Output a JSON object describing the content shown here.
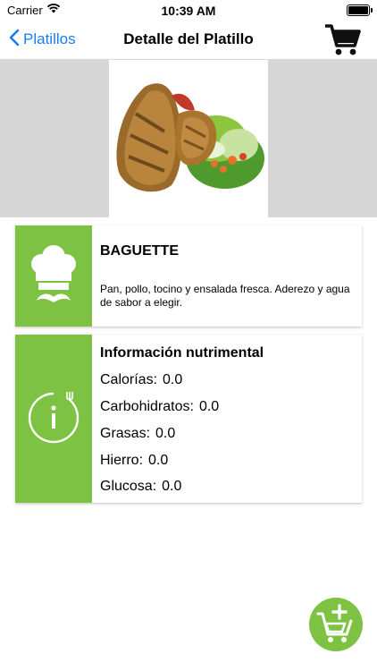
{
  "status_bar": {
    "carrier": "Carrier",
    "time": "10:39 AM"
  },
  "nav": {
    "back_label": "Platillos",
    "title": "Detalle del Platillo"
  },
  "dish": {
    "name": "BAGUETTE",
    "description": "Pan, pollo, tocino y ensalada fresca. Aderezo y agua de sabor a elegir."
  },
  "nutrition": {
    "title": "Información nutrimental",
    "items": [
      {
        "label": "Calorías:",
        "value": "0.0"
      },
      {
        "label": "Carbohidratos:",
        "value": "0.0"
      },
      {
        "label": "Grasas:",
        "value": "0.0"
      },
      {
        "label": "Hierro:",
        "value": "0.0"
      },
      {
        "label": "Glucosa:",
        "value": "0.0"
      }
    ]
  },
  "colors": {
    "accent_green": "#7dc242",
    "ios_blue": "#1a7cf5",
    "hero_background": "#d6d6d6"
  },
  "icons": {
    "wifi": "wifi-icon",
    "battery": "battery-icon",
    "back": "chevron-left-icon",
    "cart": "shopping-cart-icon",
    "chef": "chef-hat-icon",
    "info": "info-icon",
    "add_to_cart": "add-to-cart-icon"
  }
}
